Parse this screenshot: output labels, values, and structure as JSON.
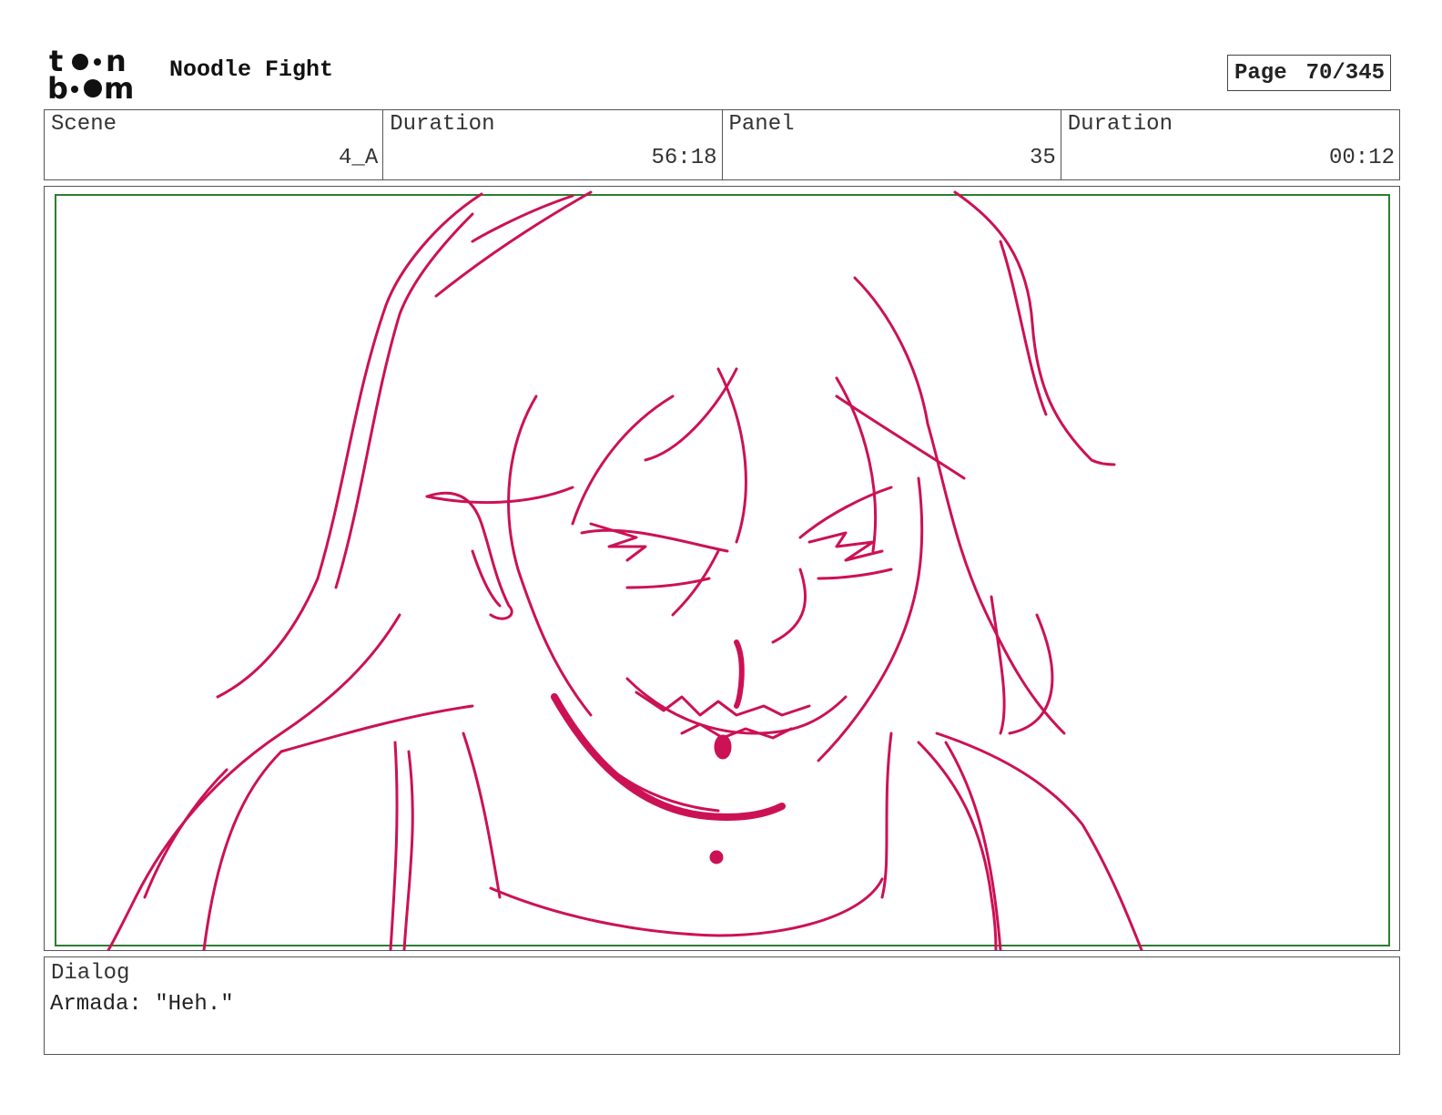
{
  "header": {
    "logo_text": "toon boom",
    "project_title": "Noodle Fight",
    "page_label": "Page",
    "page_number": "70/345"
  },
  "info": {
    "scene_label": "Scene",
    "scene_value": "4_A",
    "scene_duration_label": "Duration",
    "scene_duration_value": "56:18",
    "panel_label": "Panel",
    "panel_value": "35",
    "panel_duration_label": "Duration",
    "panel_duration_value": "00:12"
  },
  "panel": {
    "sketch_icon": "character-sketch-icon",
    "line_color": "#cc1155",
    "safe_frame_color": "#2e7d32"
  },
  "dialog": {
    "label": "Dialog",
    "text": "Armada: \"Heh.\""
  }
}
